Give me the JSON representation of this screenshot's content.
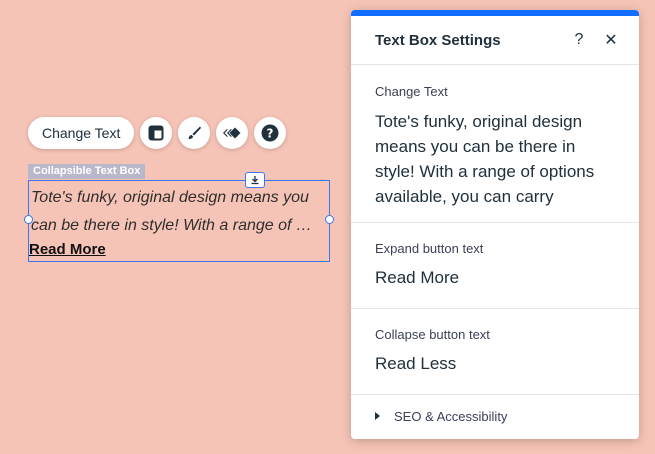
{
  "toolbar": {
    "change_text_label": "Change Text"
  },
  "element": {
    "tag_label": "Collapsible Text Box",
    "text_line1": "Tote's funky, original design means you",
    "text_line2": "can be there in style! With a range of …",
    "read_more": "Read More"
  },
  "panel": {
    "title": "Text Box Settings",
    "help_glyph": "?",
    "close_glyph": "✕",
    "change_text": {
      "label": "Change Text",
      "value": "Tote's funky, original design means you can be there in style! With a range of options available, you can carry"
    },
    "expand": {
      "label": "Expand button text",
      "value": "Read More"
    },
    "collapse": {
      "label": "Collapse button text",
      "value": "Read Less"
    },
    "seo_label": "SEO & Accessibility"
  },
  "colors": {
    "canvas_bg": "#f6c4b6",
    "accent": "#116dff",
    "selection": "#3b76ea"
  }
}
